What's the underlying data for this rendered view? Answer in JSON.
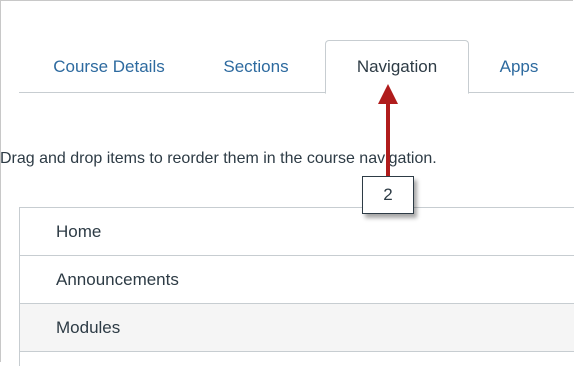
{
  "tabs": [
    {
      "label": "Course Details",
      "active": false
    },
    {
      "label": "Sections",
      "active": false
    },
    {
      "label": "Navigation",
      "active": true
    },
    {
      "label": "Apps",
      "active": false
    }
  ],
  "instruction": "Drag and drop items to reorder them in the course navigation.",
  "nav_items": [
    {
      "label": "Home"
    },
    {
      "label": "Announcements"
    },
    {
      "label": "Modules"
    }
  ],
  "callout": {
    "number": "2",
    "arrow_color": "#b01c1c"
  }
}
